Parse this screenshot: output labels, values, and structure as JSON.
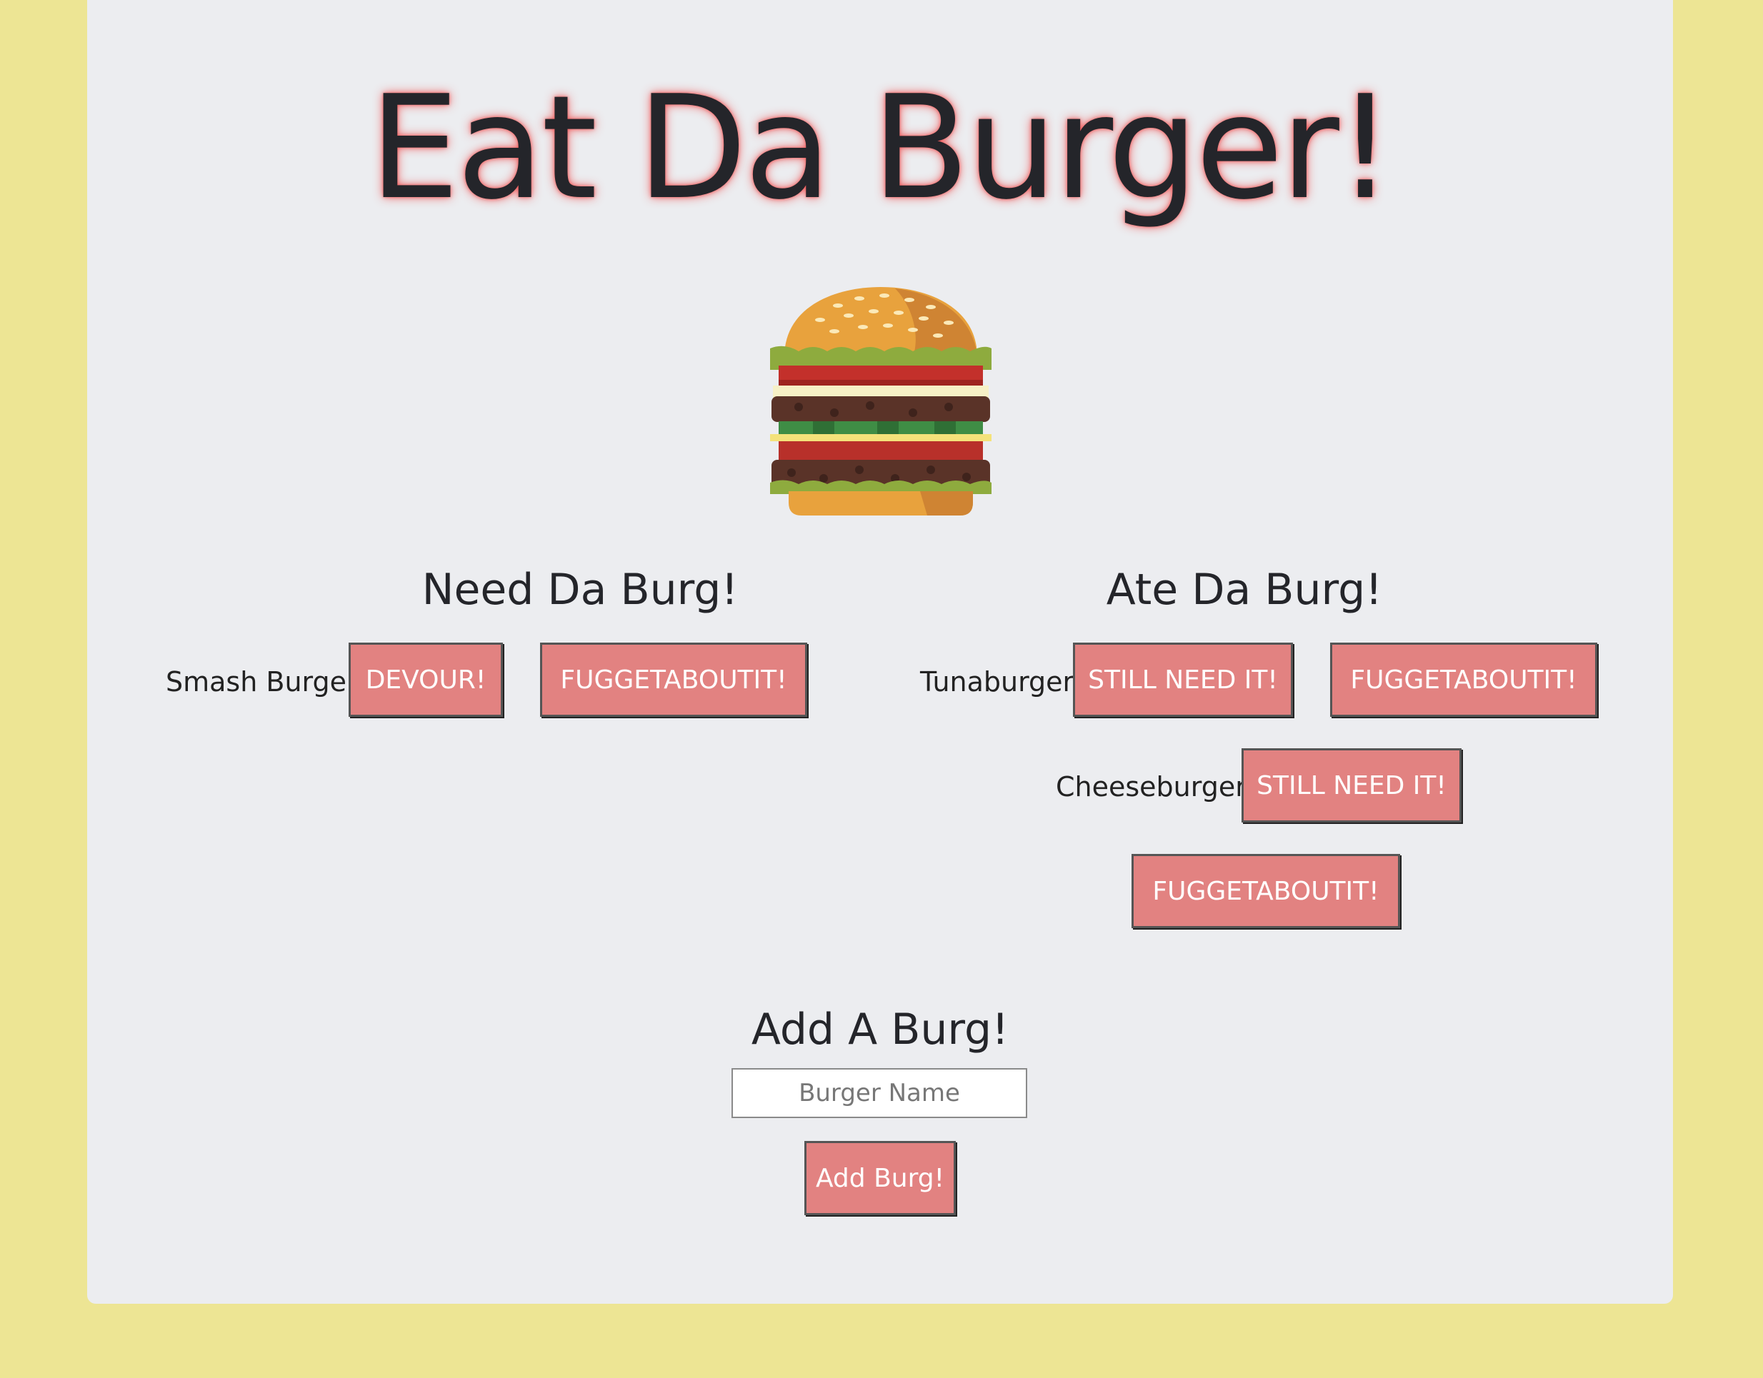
{
  "page": {
    "title": "Eat Da Burger!"
  },
  "colors": {
    "page_background": "#ede594",
    "card_background": "#ecedf0",
    "button_background": "#e28281",
    "title_glow": "#f04646"
  },
  "columns": {
    "need": {
      "heading": "Need Da Burg!",
      "items": [
        {
          "name": "Smash Burger",
          "devour_label": "DEVOUR!",
          "delete_label": "FUGGETABOUTIT!"
        }
      ]
    },
    "ate": {
      "heading": "Ate Da Burg!",
      "items": [
        {
          "name": "Tunaburger",
          "restore_label": "STILL NEED IT!",
          "delete_label": "FUGGETABOUTIT!"
        },
        {
          "name": "Cheeseburger",
          "restore_label": "STILL NEED IT!",
          "delete_label": "FUGGETABOUTIT!"
        }
      ]
    }
  },
  "add_form": {
    "heading": "Add A Burg!",
    "input_value": "",
    "input_placeholder": "Burger Name",
    "submit_label": "Add Burg!"
  }
}
